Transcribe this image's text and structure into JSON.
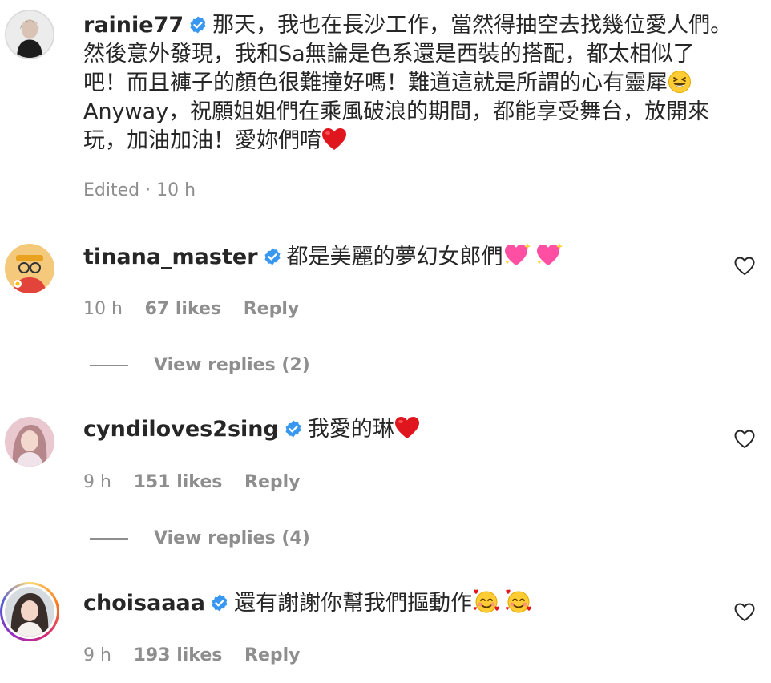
{
  "comments": [
    {
      "username": "rainie77",
      "text_lines": [
        "那天，我也在長沙工作，當然得抽空去找幾位愛人們。",
        "然後意外發現，我和Sa無論是色系還是西裝的搭配，都太相似了",
        "吧！而且褲子的顏色很難撞好嗎！難道這就是所謂的心有靈犀",
        "Anyway，祝願姐姐們在乘風破浪的期間，都能享受舞台，放開來",
        "玩，加油加油！愛妳們唷"
      ],
      "edited": "Edited · 10 h",
      "emoji": [
        "grinning-squint-emoji",
        "red-heart-emoji"
      ]
    },
    {
      "username": "tinana_master",
      "text": "都是美麗的夢幻女郎們",
      "time": "10 h",
      "likes": "67 likes",
      "reply": "Reply",
      "view_replies": "View replies (2)",
      "emoji": [
        "sparkling-heart-emoji",
        "sparkling-heart-emoji"
      ]
    },
    {
      "username": "cyndiloves2sing",
      "text": "我愛的琳",
      "time": "9 h",
      "likes": "151 likes",
      "reply": "Reply",
      "view_replies": "View replies (4)",
      "emoji": [
        "red-heart-emoji"
      ]
    },
    {
      "username": "choisaaaa",
      "text": "還有謝謝你幫我們摳動作",
      "time": "9 h",
      "likes": "193 likes",
      "reply": "Reply",
      "emoji": [
        "smiling-face-with-hearts-emoji",
        "smiling-face-with-hearts-emoji"
      ]
    }
  ],
  "colors": {
    "verified_blue": "#3897f0",
    "meta_gray": "#8e8e8e",
    "text": "#262626"
  }
}
